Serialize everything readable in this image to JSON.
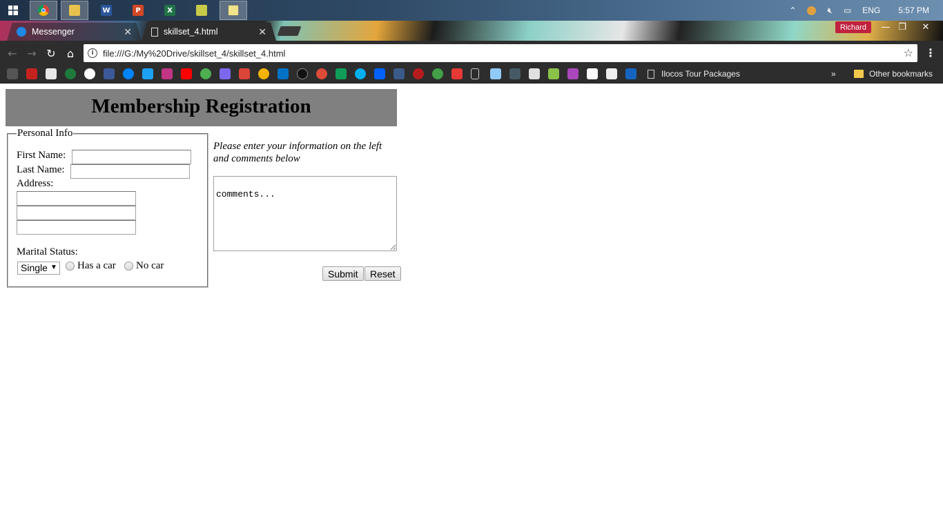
{
  "taskbar": {
    "apps": [
      {
        "name": "chrome",
        "active": true
      },
      {
        "name": "file-explorer",
        "active": true
      },
      {
        "name": "word",
        "label": "W"
      },
      {
        "name": "powerpoint",
        "label": "P"
      },
      {
        "name": "excel",
        "label": "X"
      },
      {
        "name": "folders"
      },
      {
        "name": "notepad",
        "active": true
      }
    ],
    "tray": {
      "language": "ENG",
      "time": "5:57 PM"
    }
  },
  "browser": {
    "tabs": [
      {
        "title": "Messenger",
        "icon": "messenger-icon"
      },
      {
        "title": "skillset_4.html",
        "icon": "document-icon"
      }
    ],
    "profile_name": "Richard",
    "url": "file:///G:/My%20Drive/skillset_4/skillset_4.html",
    "bookmarks": {
      "folder_label": "Ilocos Tour Packages",
      "other_label": "Other bookmarks",
      "overflow": "»"
    }
  },
  "page": {
    "title": "Membership Registration",
    "personal_info": {
      "legend": "Personal Info",
      "first_name_label": "First Name:",
      "last_name_label": "Last Name:",
      "address_label": "Address:",
      "marital_label": "Marital Status:",
      "marital_selected": "Single",
      "has_car_label": "Has a car",
      "no_car_label": "No car"
    },
    "hint": "Please enter your information on the left and comments below",
    "comments_value": "comments...",
    "submit_label": "Submit",
    "reset_label": "Reset"
  }
}
